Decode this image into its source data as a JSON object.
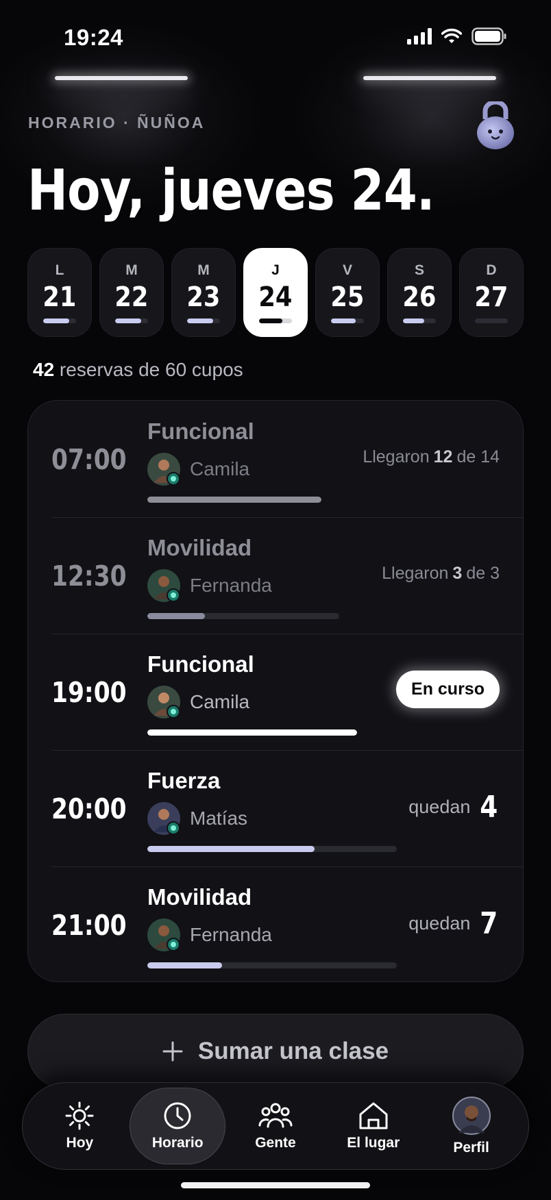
{
  "status": {
    "time": "19:24"
  },
  "header": {
    "eyebrow": "HORARIO · ÑUÑOA",
    "title": "Hoy, jueves 24."
  },
  "days": [
    {
      "wd": "L",
      "num": "21",
      "fill": 0.8,
      "selected": false
    },
    {
      "wd": "M",
      "num": "22",
      "fill": 0.8,
      "selected": false
    },
    {
      "wd": "M",
      "num": "23",
      "fill": 0.8,
      "selected": false
    },
    {
      "wd": "J",
      "num": "24",
      "fill": 0.7,
      "selected": true
    },
    {
      "wd": "V",
      "num": "25",
      "fill": 0.75,
      "selected": false
    },
    {
      "wd": "S",
      "num": "26",
      "fill": 0.65,
      "selected": false
    },
    {
      "wd": "D",
      "num": "27",
      "fill": 0,
      "selected": false
    }
  ],
  "summary": {
    "count": "42",
    "rest": " reservas de 60 cupos"
  },
  "classes": [
    {
      "time": "07:00",
      "name": "Funcional",
      "coach": "Camila",
      "state": "done",
      "pre": "Llegaron ",
      "num": "12",
      "post": " de 14",
      "fill": 1.0,
      "barColor": "#8e8e96"
    },
    {
      "time": "12:30",
      "name": "Movilidad",
      "coach": "Fernanda",
      "state": "done",
      "pre": "Llegaron ",
      "num": "3",
      "post": " de 3",
      "fill": 0.3,
      "barColor": "#8a8c9e"
    },
    {
      "time": "19:00",
      "name": "Funcional",
      "coach": "Camila",
      "state": "live",
      "pill": "En curso",
      "fill": 1.0,
      "barColor": "#ffffff"
    },
    {
      "time": "20:00",
      "name": "Fuerza",
      "coach": "Matías",
      "state": "open",
      "q": "quedan",
      "qn": "4",
      "fill": 0.67,
      "barColor": "#c9cbee"
    },
    {
      "time": "21:00",
      "name": "Movilidad",
      "coach": "Fernanda",
      "state": "open",
      "q": "quedan",
      "qn": "7",
      "fill": 0.3,
      "barColor": "#c9cbee"
    }
  ],
  "add_button": {
    "label": "Sumar una clase"
  },
  "tabs": [
    {
      "label": "Hoy",
      "icon": "sun-icon"
    },
    {
      "label": "Horario",
      "icon": "clock-icon",
      "active": true
    },
    {
      "label": "Gente",
      "icon": "people-icon"
    },
    {
      "label": "El lugar",
      "icon": "house-icon"
    },
    {
      "label": "Perfil",
      "icon": "avatar"
    }
  ]
}
